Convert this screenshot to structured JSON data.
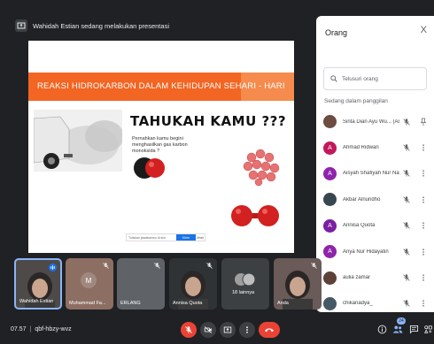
{
  "presenter_banner": {
    "text": "Wahidah Estian sedang melakukan presentasi"
  },
  "slide": {
    "title": "REAKSI HIDROKARBON DALAM KEHIDUPAN SEHARI - HARI",
    "headline": "TAHUKAH KAMU ???",
    "question": "Pernahkan kamu begini menghasilkan gas karbon monoksida ?",
    "answer_placeholder": "Tuliskan jawabanmu di sini",
    "answer_button": "Kirim",
    "answer_extra": "Ubah"
  },
  "panel": {
    "title": "Orang",
    "close_glyph": "X",
    "search_placeholder": "Telusuri orang",
    "section_label": "Sedang dalam panggilan",
    "participants": [
      {
        "name": "Sinta Dian Ayu Wu... (Anda)",
        "initial": "",
        "color": "#6d4c41"
      },
      {
        "name": "Ahmad Ridwan",
        "initial": "A",
        "color": "#c2185b"
      },
      {
        "name": "Aisyah Shafiyah Nur Nafis...",
        "initial": "A",
        "color": "#8e24aa"
      },
      {
        "name": "Akbar Alnuridho",
        "initial": "",
        "color": "#37474f"
      },
      {
        "name": "Annisa Quota",
        "initial": "A",
        "color": "#7b1fa2"
      },
      {
        "name": "Anya Nur Hidayatin",
        "initial": "A",
        "color": "#8e24aa"
      },
      {
        "name": "aulia zamar",
        "initial": "",
        "color": "#5d4037"
      },
      {
        "name": "chikanadya_",
        "initial": "",
        "color": "#455a64"
      }
    ]
  },
  "thumbnails": [
    {
      "name": "Wahidah Estian",
      "initial": "",
      "color": "#4e4a4a"
    },
    {
      "name": "Muhammad Fa...",
      "initial": "M",
      "color": "#8d6e63"
    },
    {
      "name": "ERLANG",
      "initial": "",
      "color": "#5f6368"
    },
    {
      "name": "Annisa Quota",
      "initial": "",
      "color": "#2f3336"
    },
    {
      "name": "18 lainnya",
      "initial": "",
      "color": "#3c4043"
    },
    {
      "name": "Anda",
      "initial": "",
      "color": "#6a5a58"
    }
  ],
  "bottom": {
    "time": "07.57",
    "separator": "|",
    "meeting_code": "qbf-hbzy-wvz",
    "participant_count": "24"
  },
  "colors": {
    "accent_orange": "#f26522",
    "end_call": "#ea4335",
    "panel_bg": "#ffffff",
    "dark_bg": "#202124"
  }
}
